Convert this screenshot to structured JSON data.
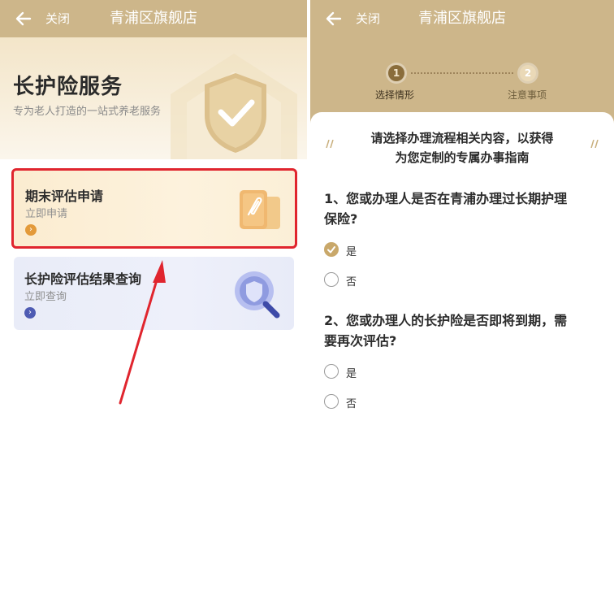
{
  "header": {
    "close_label": "关闭",
    "store_title": "青浦区旗舰店"
  },
  "left": {
    "hero": {
      "title": "长护险服务",
      "subtitle": "专为老人打造的一站式养老服务"
    },
    "cards": [
      {
        "title": "期末评估申请",
        "subtitle": "立即申请",
        "arrow_color": "#e39a3a",
        "highlighted": true
      },
      {
        "title": "长护险评估结果查询",
        "subtitle": "立即查询",
        "arrow_color": "#4e5bb3",
        "highlighted": false
      }
    ],
    "annotation_colors": {
      "highlight_border": "#e0252e",
      "pointer_arrow": "#e0252e"
    }
  },
  "right": {
    "steps": [
      {
        "number": "1",
        "label": "选择情形",
        "active": true
      },
      {
        "number": "2",
        "label": "注意事项",
        "active": false
      }
    ],
    "intro_line1": "请选择办理流程相关内容，以获得",
    "intro_line2": "为您定制的专属办事指南",
    "questions": [
      {
        "text_line1": "1、您或办理人是否在青浦办理过长期护理",
        "text_line2": "保险?",
        "options": [
          {
            "label": "是",
            "selected": true
          },
          {
            "label": "否",
            "selected": false
          }
        ]
      },
      {
        "text_line1": "2、您或办理人的长护险是否即将到期，需",
        "text_line2": "要再次评估?",
        "options": [
          {
            "label": "是",
            "selected": false
          },
          {
            "label": "否",
            "selected": false
          }
        ]
      }
    ]
  },
  "colors": {
    "brand_gold": "#cdb68a",
    "selected_radio": "#c9a86a"
  },
  "icons": [
    "back-arrow-icon",
    "shield-check-icon",
    "document-clip-icon",
    "shield-magnifier-icon",
    "chevron-right-icon",
    "checkmark-icon"
  ]
}
